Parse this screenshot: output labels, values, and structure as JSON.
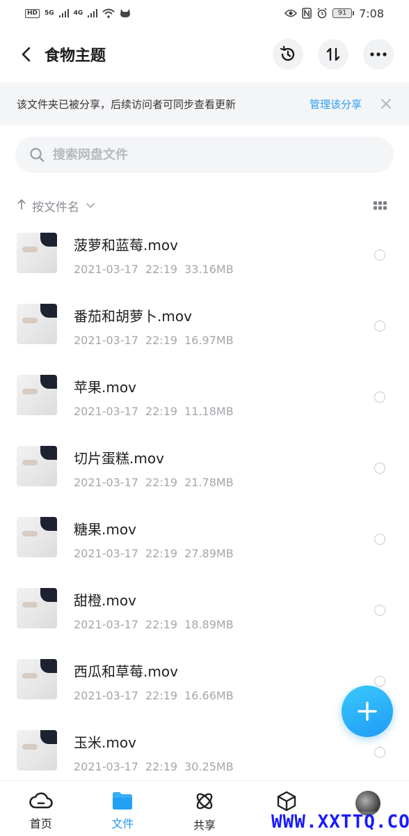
{
  "status_bar": {
    "network_badge": "HD",
    "signal_1": "5G",
    "signal_2": "4G",
    "battery": "91",
    "time": "7:08"
  },
  "header": {
    "title": "食物主题"
  },
  "share_banner": {
    "text": "该文件夹已被分享，后续访问者可同步查看更新",
    "link": "管理该分享"
  },
  "search": {
    "placeholder": "搜索网盘文件"
  },
  "sort": {
    "label": "按文件名"
  },
  "files": [
    {
      "name": "菠萝和蓝莓.mov",
      "date": "2021-03-17",
      "time": "22:19",
      "size": "33.16MB"
    },
    {
      "name": "番茄和胡萝卜.mov",
      "date": "2021-03-17",
      "time": "22:19",
      "size": "16.97MB"
    },
    {
      "name": "苹果.mov",
      "date": "2021-03-17",
      "time": "22:19",
      "size": "11.18MB"
    },
    {
      "name": "切片蛋糕.mov",
      "date": "2021-03-17",
      "time": "22:19",
      "size": "21.78MB"
    },
    {
      "name": "糖果.mov",
      "date": "2021-03-17",
      "time": "22:19",
      "size": "27.89MB"
    },
    {
      "name": "甜橙.mov",
      "date": "2021-03-17",
      "time": "22:19",
      "size": "18.89MB"
    },
    {
      "name": "西瓜和草莓.mov",
      "date": "2021-03-17",
      "time": "22:19",
      "size": "16.66MB"
    },
    {
      "name": "玉米.mov",
      "date": "2021-03-17",
      "time": "22:19",
      "size": "30.25MB"
    }
  ],
  "bottom_nav": {
    "items": [
      {
        "label": "首页",
        "icon": "cloud-home-icon"
      },
      {
        "label": "文件",
        "icon": "folder-icon"
      },
      {
        "label": "共享",
        "icon": "atom-share-icon"
      },
      {
        "label": "",
        "icon": "cube-icon"
      },
      {
        "label": "",
        "icon": "avatar"
      }
    ],
    "active_color": "#2196f3"
  },
  "watermark": "WWW.XXTTQ.COM",
  "colors": {
    "accent": "#2a9df4",
    "fab": "#1e9cf6"
  }
}
